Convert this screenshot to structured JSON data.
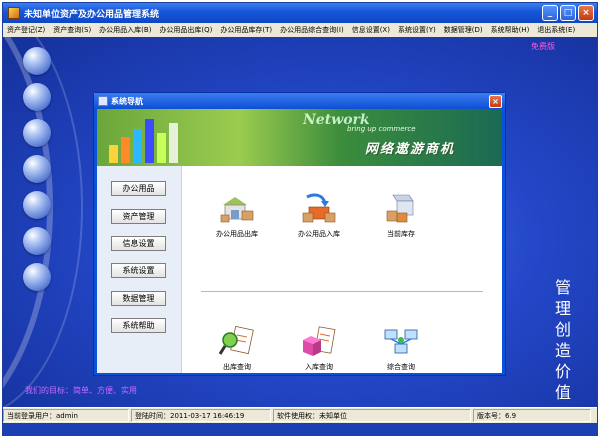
{
  "window": {
    "title": "未知单位资产及办公用品管理系统",
    "buttons": [
      "_",
      "□",
      "×"
    ]
  },
  "menubar": {
    "items": [
      "资产登记(Z)",
      "资产查询(S)",
      "办公用品入库(B)",
      "办公用品出库(Q)",
      "办公用品库存(T)",
      "办公用品综合查询(I)",
      "信息设置(X)",
      "系统设置(Y)",
      "数据管理(D)",
      "系统帮助(H)",
      "退出系统(E)"
    ]
  },
  "desktop": {
    "free_version": "免费版",
    "slogan": "管理创造价值",
    "bottom_text": "我们的目标：简单、方便、实用"
  },
  "dialog": {
    "title": "系统导航",
    "close": "×",
    "banner": {
      "network": "Network",
      "sub": "bring up commerce",
      "title": "网络遨游商机"
    },
    "nav": [
      "办公用品",
      "资产管理",
      "信息设置",
      "系统设置",
      "数据管理",
      "系统帮助"
    ],
    "tools": [
      "办公用品出库",
      "办公用品入库",
      "当前库存",
      "出库查询",
      "入库查询",
      "综合查询"
    ]
  },
  "statusbar": {
    "user": "当前登录用户：admin",
    "time": "登陆时间：2011-03-17 16:46:19",
    "licensee": "软件使用权：未知单位",
    "version": "版本号：6.9"
  },
  "colors": {
    "desktop_blue": "#2347c8",
    "title_blue": "#1556d8",
    "accent_pink": "#ff5ad9"
  }
}
